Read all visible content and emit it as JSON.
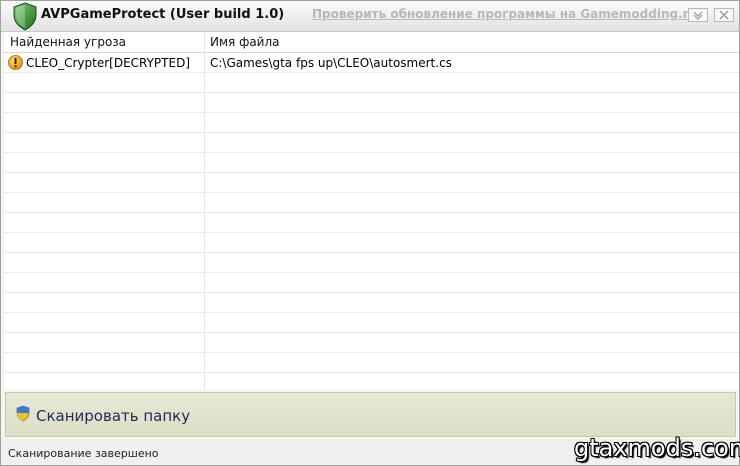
{
  "window": {
    "title": "AVPGameProtect (User build 1.0)",
    "update_link": "Проверить обновление программы на Gamemodding.net",
    "minimize_icon": "chevron-down-icon",
    "close_icon": "close-icon"
  },
  "table": {
    "columns": [
      "Найденная угроза",
      "Имя файла"
    ],
    "rows": [
      {
        "threat": "CLEO_Crypter[DECRYPTED]",
        "file": "C:\\Games\\gta fps up\\CLEO\\autosmert.cs",
        "icon": "warning-icon"
      }
    ],
    "empty_rows": 16
  },
  "scan": {
    "button_label": "Сканировать папку",
    "icon": "uac-shield-icon"
  },
  "status": {
    "text": "Сканирование завершено"
  },
  "watermark": {
    "text": "gtaxmods.com"
  },
  "colors": {
    "shield_green": "#2e8b2e",
    "warning_orange": "#f0a010",
    "scan_panel": "#e2e4cf",
    "link_gray": "#b8b8b8"
  }
}
